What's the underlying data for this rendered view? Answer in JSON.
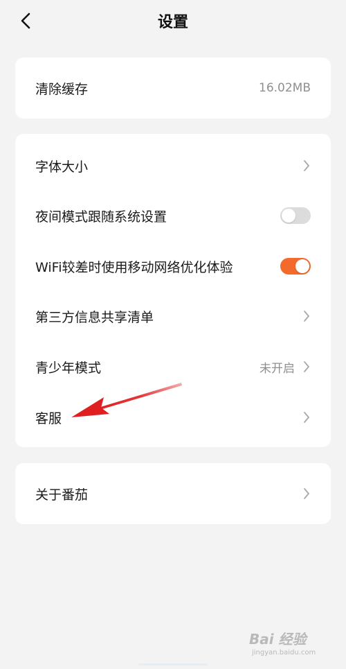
{
  "header": {
    "title": "设置",
    "back_icon": "chevron-left-icon"
  },
  "cache_card": {
    "label": "清除缓存",
    "value": "16.02MB"
  },
  "settings_card": {
    "font_size": {
      "label": "字体大小"
    },
    "night_mode": {
      "label": "夜间模式跟随系统设置",
      "toggle_on": false
    },
    "wifi_optimize": {
      "label": "WiFi较差时使用移动网络优化体验",
      "toggle_on": true
    },
    "third_party": {
      "label": "第三方信息共享清单"
    },
    "youth_mode": {
      "label": "青少年模式",
      "value": "未开启"
    },
    "customer_service": {
      "label": "客服"
    }
  },
  "about_card": {
    "label": "关于番茄"
  },
  "annotation": {
    "arrow_color": "#e02020",
    "points_to": "客服"
  },
  "watermark": {
    "main": "Bai 经验",
    "sub": "jingyan.baidu.com"
  },
  "colors": {
    "accent": "#f26b2c",
    "background": "#f3f3f4",
    "card": "#ffffff",
    "toggle_off": "#dcdcdc",
    "secondary_text": "#8f8f8f"
  }
}
